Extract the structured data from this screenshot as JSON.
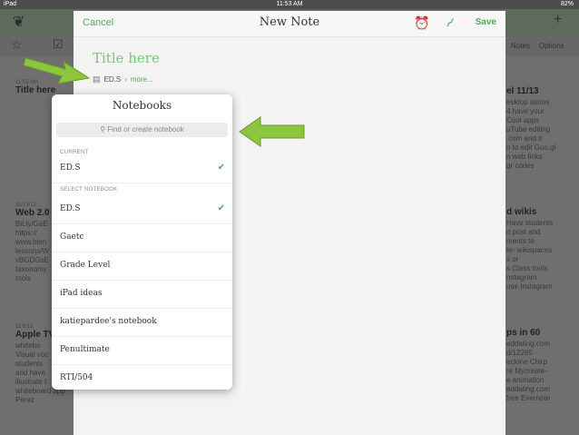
{
  "status_bar": {
    "device": "iPad",
    "time": "11:53 AM",
    "battery": "82%"
  },
  "modal": {
    "cancel_label": "Cancel",
    "title": "New Note",
    "save_label": "Save",
    "title_placeholder": "Title here",
    "notebook": "ED.S",
    "more_label": "more..."
  },
  "notebook_picker": {
    "title": "Notebooks",
    "search_placeholder": "Find or create notebook",
    "current_section": "CURRENT",
    "current_item": "ED.S",
    "select_section": "SELECT NOTEBOOK",
    "items": [
      {
        "label": "ED.S",
        "checked": true
      },
      {
        "label": "Gaetc",
        "checked": false
      },
      {
        "label": "Grade Level",
        "checked": false
      },
      {
        "label": "iPad ideas",
        "checked": false
      },
      {
        "label": "katiepardee's notebook",
        "checked": false
      },
      {
        "label": "Penultimate",
        "checked": false
      },
      {
        "label": "RTI/504",
        "checked": false
      }
    ]
  },
  "background": {
    "left_notes": [
      {
        "date": "11:53 AM",
        "title": "Title here",
        "lines": []
      },
      {
        "date": "11/13/13",
        "title": "Web 2.0",
        "lines": [
          "Bit.ly/GaE",
          "https://",
          "www.blen",
          "lessons/W",
          "vBGDGsE",
          "taxonomy",
          "tools"
        ]
      },
      {
        "date": "11/8/13",
        "title": "Apple TV",
        "lines": [
          "whitebo",
          "Visual voc",
          "students",
          "and have",
          "illustrate t",
          "whiteboard app",
          "Perez"
        ]
      }
    ],
    "right_notes": [
      {
        "title": "el 11/13",
        "lines": [
          "esktop stores",
          "4 have your",
          "Cool apps",
          "uTube editing",
          ".com and it",
          "n to edit Goo.gl",
          "n web links",
          "qr codes"
        ]
      },
      {
        "title": "d wikis",
        "lines": [
          "Have students",
          "o post and",
          "ments to",
          "te- wikispaces",
          "s or",
          "s Class tools",
          "nstagram",
          "use Instagram"
        ]
      },
      {
        "title": "ps in 60",
        "lines": [
          "eddating.com",
          "d/12265",
          "eclone Chirp",
          "re Mycreate-",
          "e animation",
          "eddating.com",
          "free Evernote"
        ]
      }
    ],
    "toolbar_labels": {
      "notes": "Notes",
      "options": "Options"
    }
  },
  "colors": {
    "accent": "#4caf50",
    "arrow": "#8cc63f"
  }
}
